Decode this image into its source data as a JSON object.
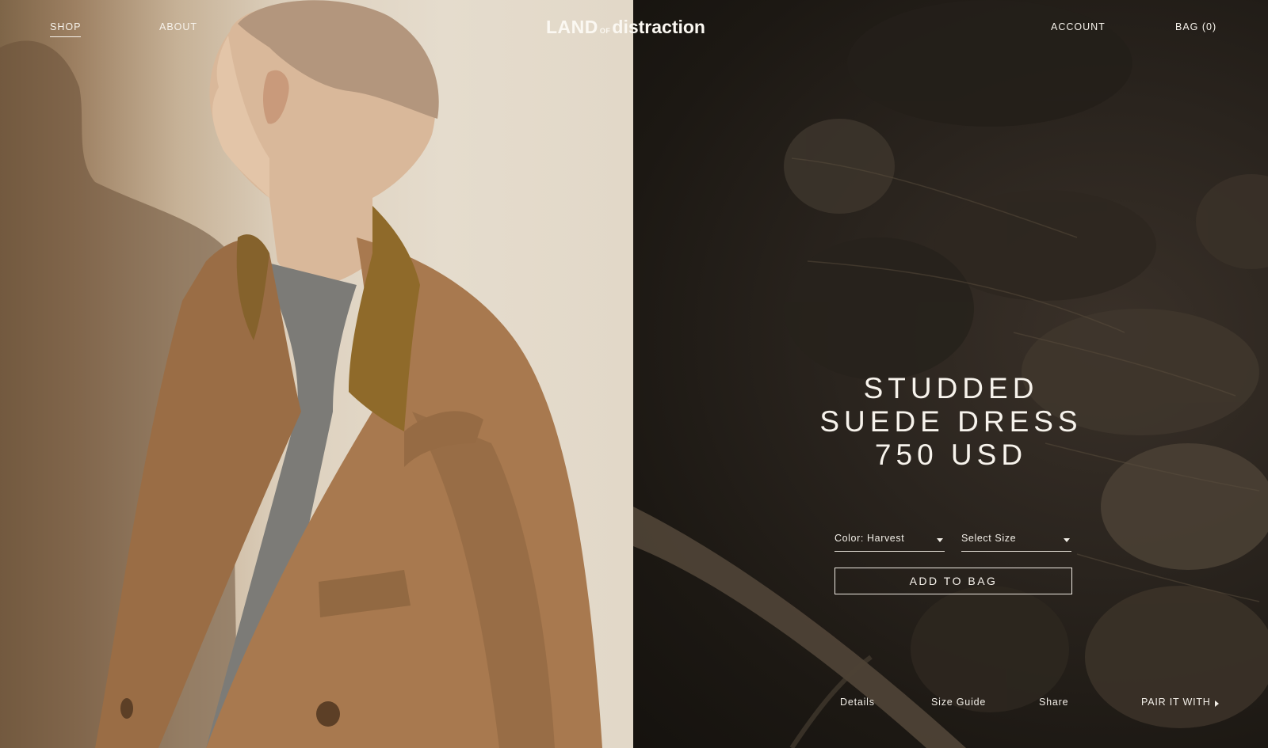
{
  "header": {
    "nav_left": [
      "SHOP",
      "ABOUT"
    ],
    "logo": {
      "part1": "LAND",
      "part2": "OF",
      "part3": "distraction"
    },
    "account": "ACCOUNT",
    "bag": "BAG  (0)"
  },
  "product": {
    "name_line1": "STUDDED",
    "name_line2": "SUEDE DRESS",
    "price": "750 USD",
    "color_select": "Color: Harvest",
    "size_select": "Select Size",
    "add_to_bag": "ADD TO BAG"
  },
  "footer_links": {
    "details": "Details",
    "size_guide": "Size Guide",
    "share": "Share",
    "pair_it_with": "PAIR IT WITH"
  },
  "colors": {
    "text_light": "#f7f3ec",
    "dark_bg": "#1d1914",
    "coat": "#a4754c",
    "collar": "#8f6a2a"
  }
}
